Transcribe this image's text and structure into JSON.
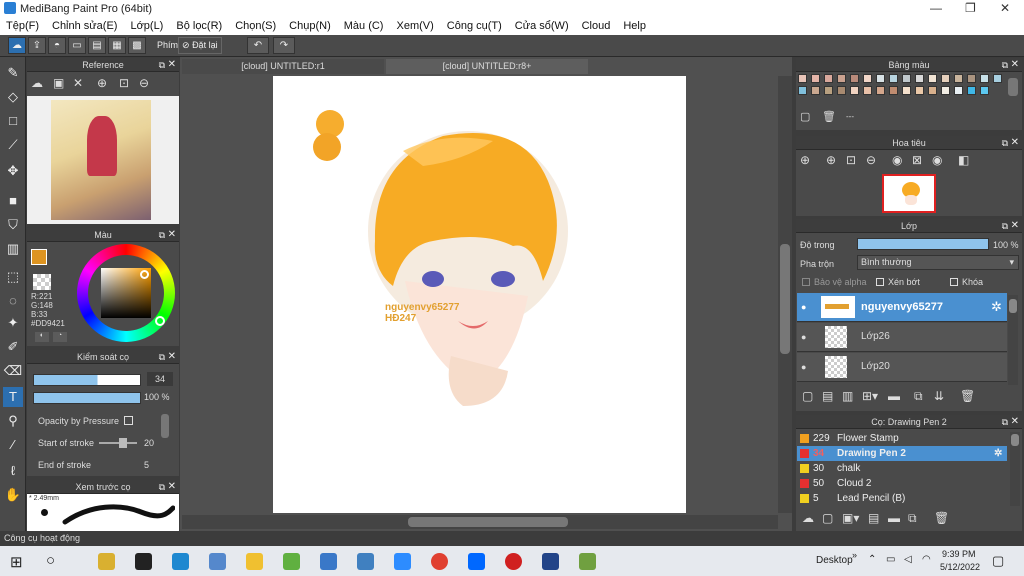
{
  "window": {
    "title": "MediBang Paint Pro (64bit)",
    "min": "—",
    "max": "❐",
    "close": "✕"
  },
  "menu": [
    "Tệp(F)",
    "Chỉnh sửa(E)",
    "Lớp(L)",
    "Bộ lọc(R)",
    "Chọn(S)",
    "Chụp(N)",
    "Màu (C)",
    "Xem(V)",
    "Công cụ(T)",
    "Cửa sổ(W)",
    "Cloud",
    "Help"
  ],
  "toolbar": {
    "phim_label": "Phím",
    "reset_label": "Đặt lại"
  },
  "tabs": [
    "[cloud] UNTITLED:r1",
    "[cloud] UNTITLED:r8+"
  ],
  "panels": {
    "reference": "Reference",
    "color": "Màu",
    "brush_control": "Kiểm soát cọ",
    "brush_preview": "Xem trước cọ",
    "palette": "Bảng màu",
    "navigator": "Hoa tiêu",
    "layer": "Lớp",
    "brush": "Cọ: Drawing Pen 2"
  },
  "color_values": {
    "r": "R:221",
    "g": "G:148",
    "b": "B:33",
    "hex": "#DD9421",
    "current": "#DD9421"
  },
  "brush_control": {
    "size": "34",
    "opacity": "100 %",
    "opacity_by_pressure": "Opacity by Pressure",
    "start_stroke": "Start of stroke",
    "start_val": "20",
    "end_stroke": "End of stroke",
    "end_val": "5"
  },
  "brush_preview": {
    "size_label": "* 2.49mm"
  },
  "palette": {
    "dash": "---",
    "colors": [
      "#e8c4b8",
      "#e4b4a8",
      "#d9a89c",
      "#caa18f",
      "#b98a7a",
      "#f2d6c8",
      "#d8e2e6",
      "#b8d4e0",
      "#c0c8cc",
      "#d9d9d9",
      "#f2e4d4",
      "#e6d0bc",
      "#c9b49c",
      "#aa9480",
      "#c7e0e8",
      "#a7cfe0",
      "#80c0dc",
      "#caa890",
      "#b8a080",
      "#a88a70",
      "#f0d2c0",
      "#e8c0a8",
      "#d4a68c",
      "#c08c70",
      "#f4e0cc",
      "#eac8a8",
      "#d8b08c",
      "#f2ede4",
      "#e9f0f4",
      "#3fb8e8",
      "#5cc8f0"
    ]
  },
  "layer": {
    "opacity_label": "Độ trong",
    "opacity_val": "100 %",
    "blend_label": "Pha trộn",
    "blend_val": "Bình thường",
    "protect_alpha": "Bảo vệ alpha",
    "clip": "Xén bớt",
    "lock": "Khóa",
    "rows": [
      {
        "name": "nguyenvy65277"
      },
      {
        "name": "Lớp26"
      },
      {
        "name": "Lớp20"
      }
    ]
  },
  "brushes": [
    {
      "size": "229",
      "name": "Flower Stamp",
      "color": "#f0a020"
    },
    {
      "size": "34",
      "name": "Drawing Pen 2",
      "color": "#e63030"
    },
    {
      "size": "30",
      "name": "chalk",
      "color": "#f0d020"
    },
    {
      "size": "50",
      "name": "Cloud 2",
      "color": "#e63030"
    },
    {
      "size": "5",
      "name": "Lead Pencil (B)",
      "color": "#f0d020"
    }
  ],
  "canvas": {
    "sig1": "nguyenvy65277",
    "sig2": "HĐ247"
  },
  "status": "Công cụ hoạt động",
  "taskbar": {
    "desktop": "Desktop",
    "time": "9:39 PM",
    "date": "5/12/2022"
  }
}
